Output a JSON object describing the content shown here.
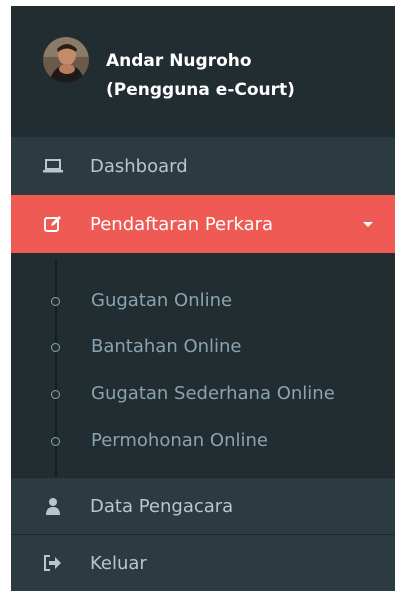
{
  "user": {
    "name": "Andar Nugroho",
    "role": "(Pengguna e-Court)"
  },
  "menu": {
    "dashboard": {
      "label": "Dashboard",
      "icon": "laptop-icon"
    },
    "pendaftaran": {
      "label": "Pendaftaran Perkara",
      "icon": "edit-icon",
      "expanded": true
    },
    "submenu": [
      {
        "label": "Gugatan Online"
      },
      {
        "label": "Bantahan Online"
      },
      {
        "label": "Gugatan Sederhana Online"
      },
      {
        "label": "Permohonan Online"
      }
    ],
    "data_pengacara": {
      "label": "Data Pengacara",
      "icon": "user-icon"
    },
    "keluar": {
      "label": "Keluar",
      "icon": "sign-out-icon"
    }
  },
  "colors": {
    "sidebar_bg": "#222d32",
    "item_bg": "#2c3b41",
    "active_bg": "#f05a55",
    "text": "#b8c7ce"
  }
}
